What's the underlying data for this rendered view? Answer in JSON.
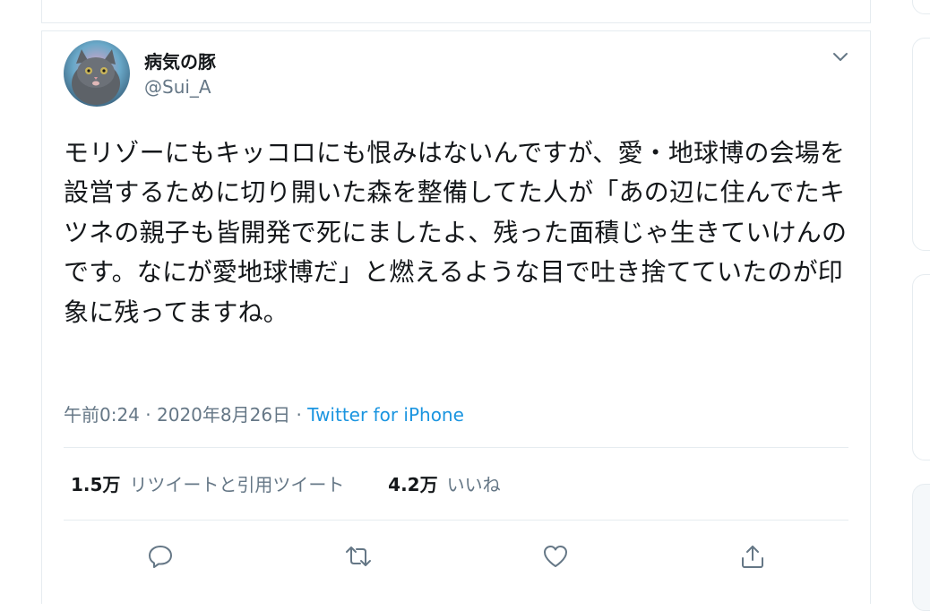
{
  "tweet": {
    "display_name": "病気の豚",
    "handle": "@Sui_A",
    "text": "モリゾーにもキッコロにも恨みはないんですが、愛・地球博の会場を設営するために切り開いた森を整備してた人が「あの辺に住んでたキツネの親子も皆開発で死にましたよ、残った面積じゃ生きていけんのです。なにが愛地球博だ」と燃えるような目で吐き捨てていたのが印象に残ってますね。",
    "time": "午前0:24",
    "date": "2020年8月26日",
    "separator": "·",
    "source": "Twitter for iPhone",
    "retweets_count": "1.5万",
    "retweets_label": "リツイートと引用ツイート",
    "likes_count": "4.2万",
    "likes_label": "いいね"
  },
  "icons": {
    "avatar": "cat-avatar",
    "more": "chevron-down-icon",
    "reply": "reply-icon",
    "retweet": "retweet-icon",
    "like": "heart-icon",
    "share": "share-icon"
  },
  "colors": {
    "text": "#14171a",
    "secondary": "#657786",
    "link": "#1b95e0",
    "border": "#e6ecf0"
  }
}
